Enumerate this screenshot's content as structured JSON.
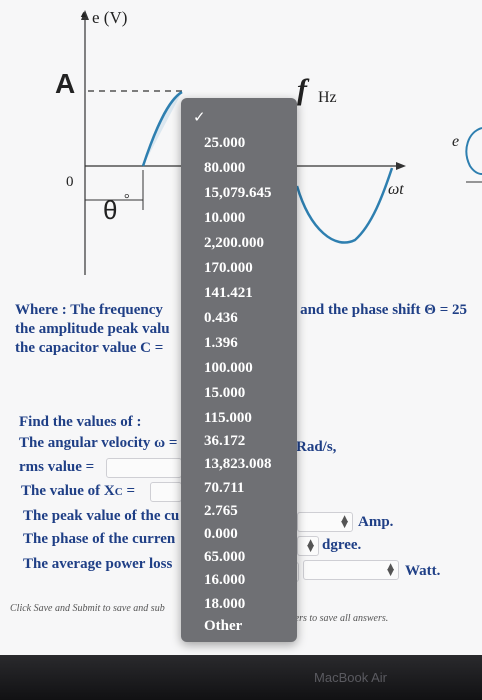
{
  "graph": {
    "axis_y_label": "e (V)",
    "amplitude_label": "A",
    "origin_label": "0",
    "theta_label": "θ",
    "degree_symbol": "°",
    "freq_symbol": "f",
    "freq_unit": "Hz",
    "omega_t_label": "ωt",
    "e_label": "e"
  },
  "problem": {
    "line1_start": "Where : The frequency",
    "line1_end": "d and the phase shift Θ = 25",
    "line2": "the amplitude peak valu",
    "line3": "the capacitor value C ="
  },
  "questions": {
    "heading": "Find the values of :",
    "angular_velocity": "The angular velocity ω =",
    "angular_velocity_unit": "Rad/s,",
    "rms_value": "rms value =",
    "xc_label": "The value of X",
    "xc_subscript": "C",
    "xc_equals": " =",
    "peak_current": "The peak value of the cu",
    "peak_current_unit": "Amp.",
    "phase_current": "The phase of the curren",
    "phase_current_unit": "dgree.",
    "avg_power": "The average power loss",
    "avg_power_unit": "Watt."
  },
  "footer": {
    "left": "Click Save and Submit to save and sub",
    "right": "wers to save all answers."
  },
  "dropdown": {
    "check": "✓",
    "options": [
      "25.000",
      "80.000",
      "15,079.645",
      "10.000",
      "2,200.000",
      "170.000",
      "141.421",
      "0.436",
      "1.396",
      "100.000",
      "15.000",
      "115.000",
      "36.172",
      "13,823.008",
      "70.711",
      "2.765",
      "0.000",
      "65.000",
      "16.000",
      "18.000",
      "Other"
    ]
  },
  "bezel": {
    "label": "MacBook Air"
  },
  "colors": {
    "text_blue": "#1f3f86",
    "wave_blue": "#2e7fb0",
    "dropdown_bg": "#6f7074"
  }
}
